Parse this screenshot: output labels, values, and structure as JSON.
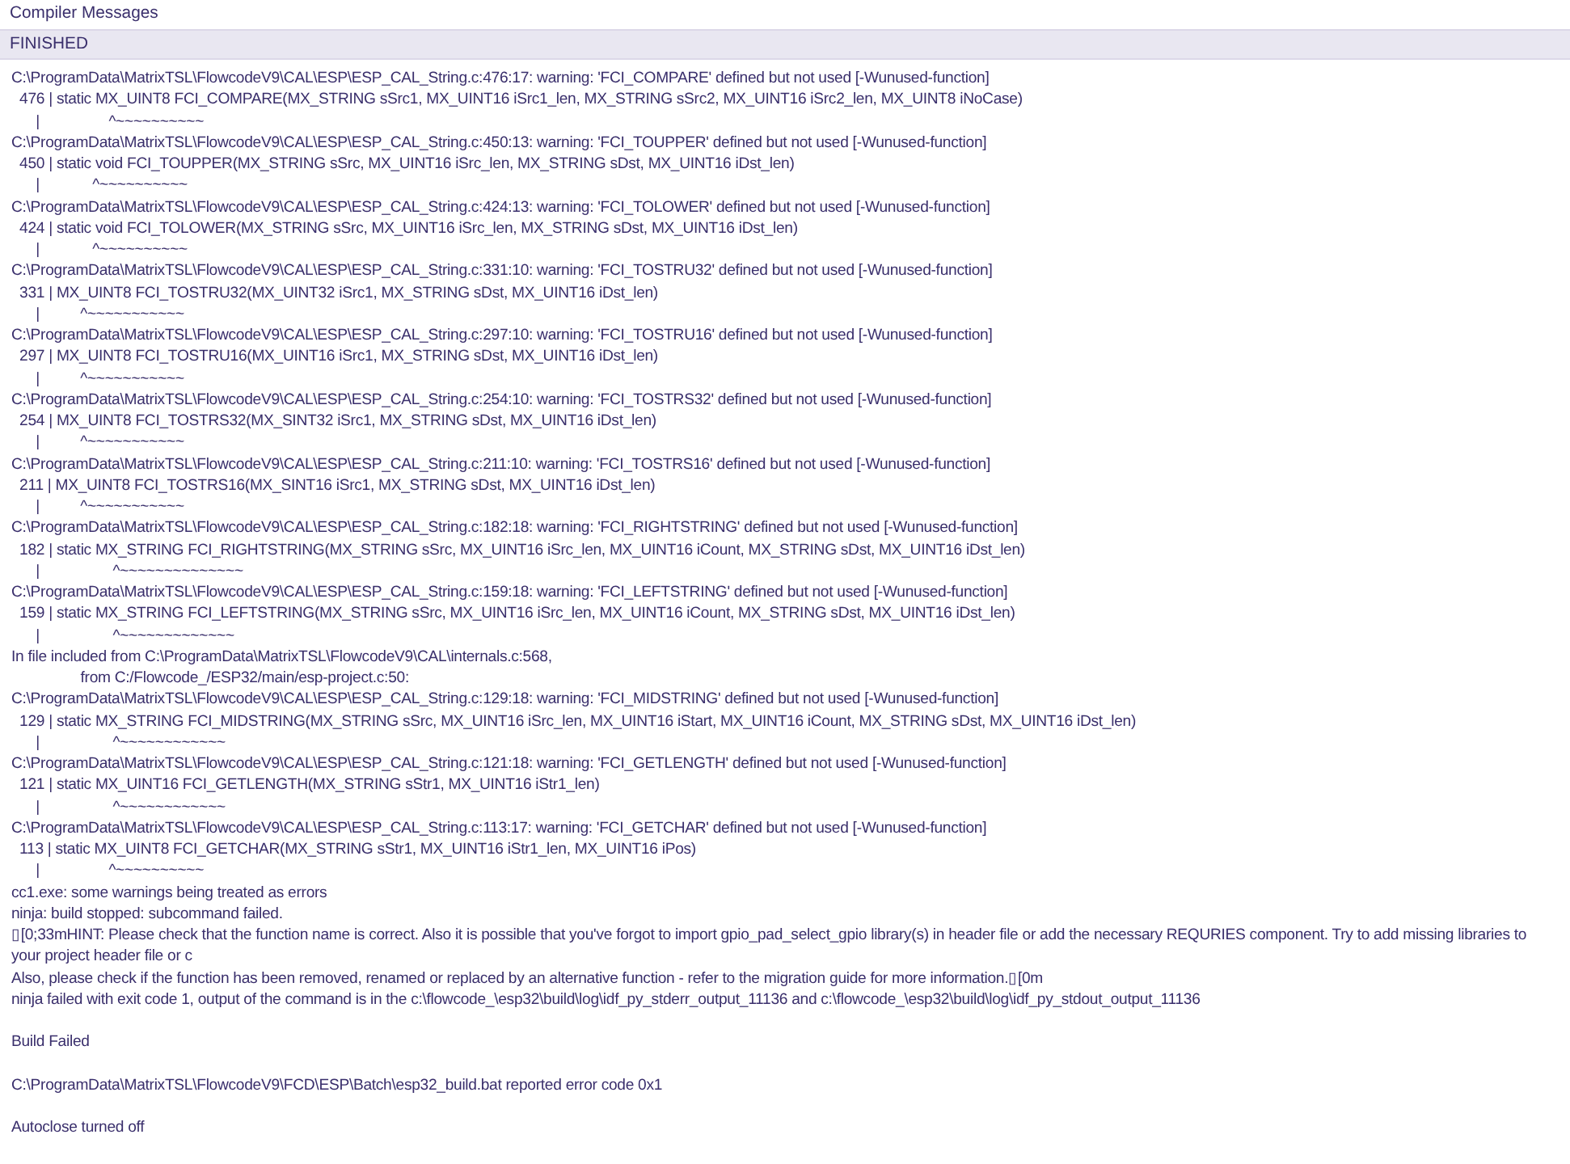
{
  "panel": {
    "title": "Compiler Messages",
    "status": "FINISHED",
    "blocks": [
      [
        "C:\\ProgramData\\MatrixTSL\\FlowcodeV9\\CAL\\ESP\\ESP_CAL_String.c:476:17: warning: 'FCI_COMPARE' defined but not used [-Wunused-function]",
        "  476 | static MX_UINT8 FCI_COMPARE(MX_STRING sSrc1, MX_UINT16 iSrc1_len, MX_STRING sSrc2, MX_UINT16 iSrc2_len, MX_UINT8 iNoCase)",
        "      |                 ^~~~~~~~~~~",
        "C:\\ProgramData\\MatrixTSL\\FlowcodeV9\\CAL\\ESP\\ESP_CAL_String.c:450:13: warning: 'FCI_TOUPPER' defined but not used [-Wunused-function]",
        "  450 | static void FCI_TOUPPER(MX_STRING sSrc, MX_UINT16 iSrc_len, MX_STRING sDst, MX_UINT16 iDst_len)",
        "      |             ^~~~~~~~~~~",
        "C:\\ProgramData\\MatrixTSL\\FlowcodeV9\\CAL\\ESP\\ESP_CAL_String.c:424:13: warning: 'FCI_TOLOWER' defined but not used [-Wunused-function]",
        "  424 | static void FCI_TOLOWER(MX_STRING sSrc, MX_UINT16 iSrc_len, MX_STRING sDst, MX_UINT16 iDst_len)",
        "      |             ^~~~~~~~~~~",
        "C:\\ProgramData\\MatrixTSL\\FlowcodeV9\\CAL\\ESP\\ESP_CAL_String.c:331:10: warning: 'FCI_TOSTRU32' defined but not used [-Wunused-function]",
        "  331 | MX_UINT8 FCI_TOSTRU32(MX_UINT32 iSrc1, MX_STRING sDst, MX_UINT16 iDst_len)",
        "      |          ^~~~~~~~~~~~",
        "C:\\ProgramData\\MatrixTSL\\FlowcodeV9\\CAL\\ESP\\ESP_CAL_String.c:297:10: warning: 'FCI_TOSTRU16' defined but not used [-Wunused-function]",
        "  297 | MX_UINT8 FCI_TOSTRU16(MX_UINT16 iSrc1, MX_STRING sDst, MX_UINT16 iDst_len)",
        "      |          ^~~~~~~~~~~~",
        "C:\\ProgramData\\MatrixTSL\\FlowcodeV9\\CAL\\ESP\\ESP_CAL_String.c:254:10: warning: 'FCI_TOSTRS32' defined but not used [-Wunused-function]",
        "  254 | MX_UINT8 FCI_TOSTRS32(MX_SINT32 iSrc1, MX_STRING sDst, MX_UINT16 iDst_len)",
        "      |          ^~~~~~~~~~~~",
        "C:\\ProgramData\\MatrixTSL\\FlowcodeV9\\CAL\\ESP\\ESP_CAL_String.c:211:10: warning: 'FCI_TOSTRS16' defined but not used [-Wunused-function]",
        "  211 | MX_UINT8 FCI_TOSTRS16(MX_SINT16 iSrc1, MX_STRING sDst, MX_UINT16 iDst_len)",
        "      |          ^~~~~~~~~~~~",
        "C:\\ProgramData\\MatrixTSL\\FlowcodeV9\\CAL\\ESP\\ESP_CAL_String.c:182:18: warning: 'FCI_RIGHTSTRING' defined but not used [-Wunused-function]",
        "  182 | static MX_STRING FCI_RIGHTSTRING(MX_STRING sSrc, MX_UINT16 iSrc_len, MX_UINT16 iCount, MX_STRING sDst, MX_UINT16 iDst_len)",
        "      |                  ^~~~~~~~~~~~~~~",
        "C:\\ProgramData\\MatrixTSL\\FlowcodeV9\\CAL\\ESP\\ESP_CAL_String.c:159:18: warning: 'FCI_LEFTSTRING' defined but not used [-Wunused-function]",
        "  159 | static MX_STRING FCI_LEFTSTRING(MX_STRING sSrc, MX_UINT16 iSrc_len, MX_UINT16 iCount, MX_STRING sDst, MX_UINT16 iDst_len)",
        "      |                  ^~~~~~~~~~~~~~",
        "In file included from C:\\ProgramData\\MatrixTSL\\FlowcodeV9\\CAL\\internals.c:568,",
        "                 from C:/Flowcode_/ESP32/main/esp-project.c:50:",
        "C:\\ProgramData\\MatrixTSL\\FlowcodeV9\\CAL\\ESP\\ESP_CAL_String.c:129:18: warning: 'FCI_MIDSTRING' defined but not used [-Wunused-function]",
        "  129 | static MX_STRING FCI_MIDSTRING(MX_STRING sSrc, MX_UINT16 iSrc_len, MX_UINT16 iStart, MX_UINT16 iCount, MX_STRING sDst, MX_UINT16 iDst_len)",
        "      |                  ^~~~~~~~~~~~~",
        "C:\\ProgramData\\MatrixTSL\\FlowcodeV9\\CAL\\ESP\\ESP_CAL_String.c:121:18: warning: 'FCI_GETLENGTH' defined but not used [-Wunused-function]",
        "  121 | static MX_UINT16 FCI_GETLENGTH(MX_STRING sStr1, MX_UINT16 iStr1_len)",
        "      |                  ^~~~~~~~~~~~~",
        "C:\\ProgramData\\MatrixTSL\\FlowcodeV9\\CAL\\ESP\\ESP_CAL_String.c:113:17: warning: 'FCI_GETCHAR' defined but not used [-Wunused-function]",
        "  113 | static MX_UINT8 FCI_GETCHAR(MX_STRING sStr1, MX_UINT16 iStr1_len, MX_UINT16 iPos)",
        "      |                 ^~~~~~~~~~~",
        "cc1.exe: some warnings being treated as errors",
        "ninja: build stopped: subcommand failed.",
        "▯[0;33mHINT: Please check that the function name is correct. Also it is possible that you've forgot to import gpio_pad_select_gpio library(s) in header file or add the necessary REQURIES component. Try to add missing libraries to your project header file or c",
        "Also, please check if the function has been removed, renamed or replaced by an alternative function - refer to the migration guide for more information.▯[0m",
        "ninja failed with exit code 1, output of the command is in the c:\\flowcode_\\esp32\\build\\log\\idf_py_stderr_output_11136 and c:\\flowcode_\\esp32\\build\\log\\idf_py_stdout_output_11136"
      ],
      [
        "Build Failed"
      ],
      [
        "C:\\ProgramData\\MatrixTSL\\FlowcodeV9\\FCD\\ESP\\Batch\\esp32_build.bat reported error code 0x1"
      ],
      [
        "Autoclose turned off"
      ]
    ]
  }
}
